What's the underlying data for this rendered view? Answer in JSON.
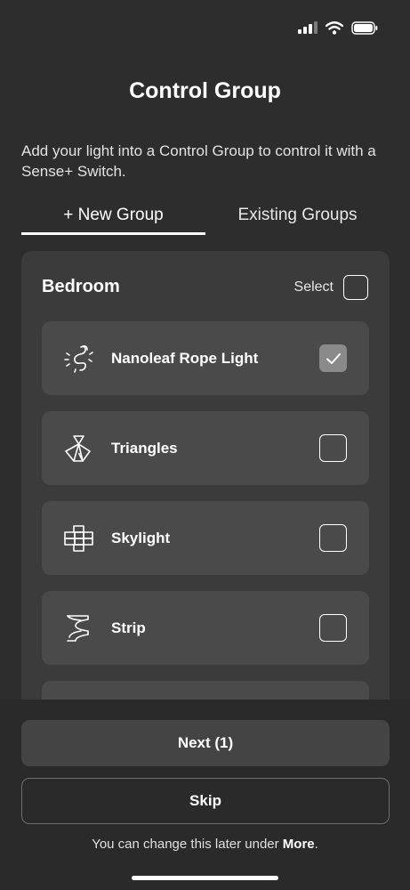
{
  "status_bar": {
    "signal_icon": "cellular-signal-icon",
    "wifi_icon": "wifi-icon",
    "battery_icon": "battery-icon"
  },
  "header": {
    "title": "Control Group",
    "subtitle": "Add your light into a Control Group to control it with a Sense+ Switch."
  },
  "tabs": [
    {
      "label": "+ New Group",
      "active": true
    },
    {
      "label": "Existing Groups",
      "active": false
    }
  ],
  "group": {
    "name": "Bedroom",
    "select_label": "Select",
    "devices": [
      {
        "label": "Nanoleaf Rope Light",
        "icon": "rope-light-icon",
        "checked": true
      },
      {
        "label": "Triangles",
        "icon": "triangles-icon",
        "checked": false
      },
      {
        "label": "Skylight",
        "icon": "skylight-icon",
        "checked": false
      },
      {
        "label": "Strip",
        "icon": "strip-icon",
        "checked": false
      }
    ]
  },
  "actions": {
    "next_label": "Next (1)",
    "skip_label": "Skip",
    "footnote_prefix": "You can change this later under ",
    "footnote_link": "More",
    "footnote_suffix": "."
  },
  "colors": {
    "background": "#2d2d2e",
    "panel": "#3b3b3c",
    "row": "#4a4a4b",
    "checked": "#8a8a8a"
  }
}
